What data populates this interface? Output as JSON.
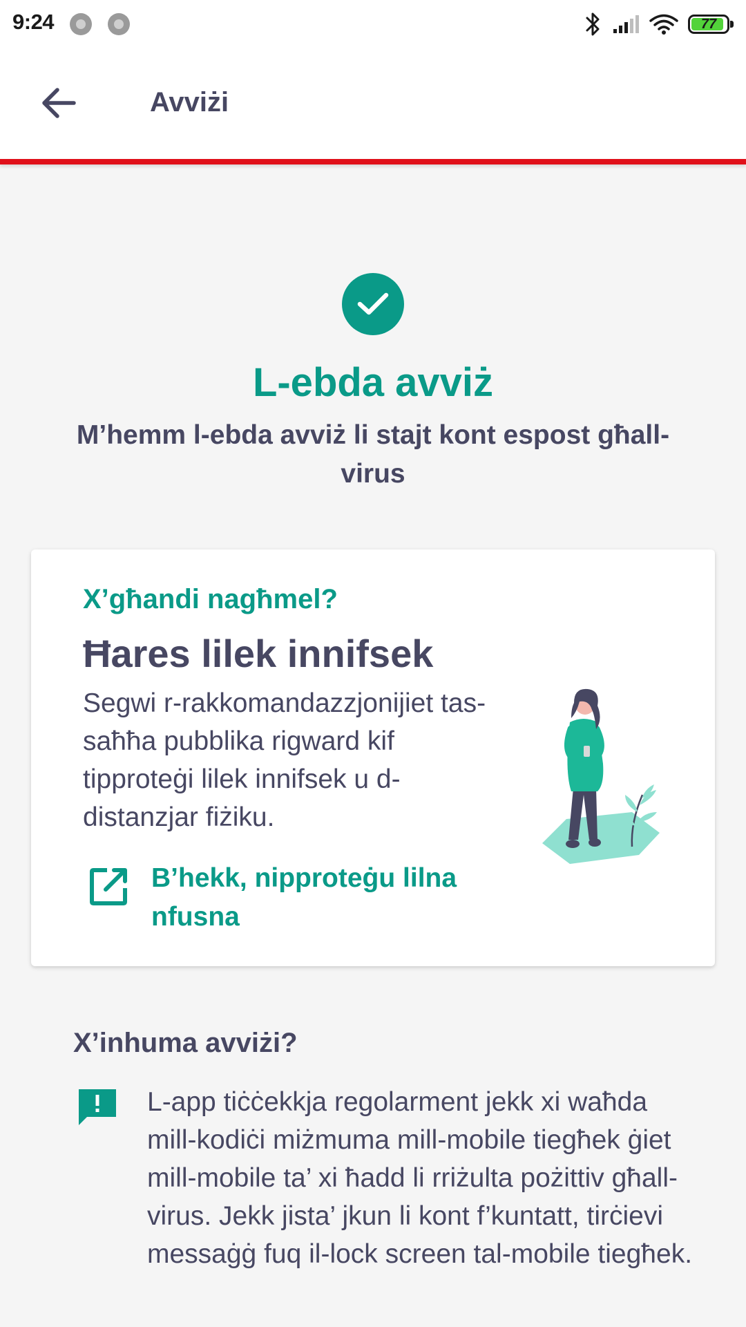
{
  "status_bar": {
    "time": "9:24",
    "battery_level": "77",
    "icons": [
      "record-icon",
      "record-icon",
      "bluetooth-icon",
      "signal-icon",
      "wifi-icon",
      "battery-icon"
    ]
  },
  "app_bar": {
    "title": "Avviżi",
    "back_icon": "arrow-left-icon"
  },
  "hero": {
    "icon": "check-icon",
    "title": "L-ebda avviż",
    "subtitle": "M’hemm l-ebda avviż li stajt kont espost għall-virus"
  },
  "card": {
    "eyebrow": "X’għandi nagħmel?",
    "heading": "Ħares lilek innifsek",
    "body": "Segwi r-rakkomandazzjonijiet tas-saħħa pubblika rigward kif tipproteġi lilek innifsek u d-distanzjar fiżiku.",
    "link_label": "B’hekk, nipproteġu lilna nfusna",
    "link_icon": "open-external-icon"
  },
  "info": {
    "heading": "X’inhuma avviżi?",
    "icon": "alert-message-icon",
    "text": "L-app tiċċekkja regolarment jekk xi waħda mill-kodiċi miżmuma mill-mobile tiegħek ġiet mill-mobile ta’ xi ħadd li rriżulta pożittiv għall-virus. Jekk jista’ jkun li kont f’kuntatt, tirċievi messaġġ fuq il-lock screen tal-mobile tiegħek."
  },
  "colors": {
    "accent": "#0a9a88",
    "text": "#474762",
    "divider": "#e0101a",
    "background": "#f5f5f5"
  }
}
